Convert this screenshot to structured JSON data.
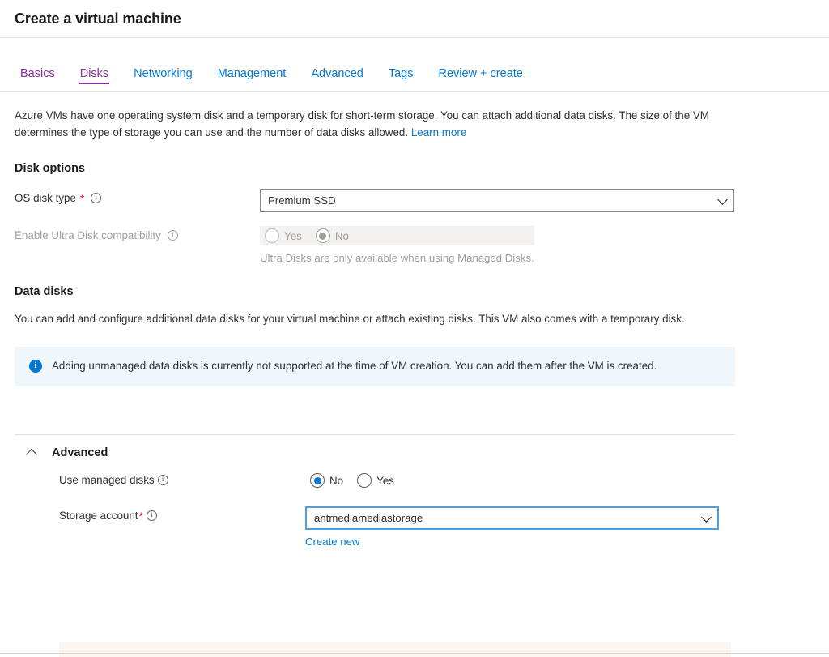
{
  "header": {
    "title": "Create a virtual machine"
  },
  "tabs": [
    {
      "label": "Basics",
      "state": "visited"
    },
    {
      "label": "Disks",
      "state": "active"
    },
    {
      "label": "Networking",
      "state": "default"
    },
    {
      "label": "Management",
      "state": "default"
    },
    {
      "label": "Advanced",
      "state": "default"
    },
    {
      "label": "Tags",
      "state": "default"
    },
    {
      "label": "Review + create",
      "state": "default"
    }
  ],
  "intro": {
    "text": "Azure VMs have one operating system disk and a temporary disk for short-term storage. You can attach additional data disks. The size of the VM determines the type of storage you can use and the number of data disks allowed.",
    "link_label": "Learn more"
  },
  "disk_options": {
    "heading": "Disk options",
    "os_disk_type": {
      "label": "OS disk type",
      "required_marker": "*",
      "value": "Premium SSD",
      "info_icon": "info-icon",
      "chevron_icon": "chevron-down-icon"
    },
    "ultra_disk": {
      "label": "Enable Ultra Disk compatibility",
      "info_icon": "info-icon",
      "options": [
        {
          "label": "Yes",
          "checked": false
        },
        {
          "label": "No",
          "checked": true
        }
      ],
      "hint": "Ultra Disks are only available when using Managed Disks.",
      "disabled": true
    }
  },
  "data_disks": {
    "heading": "Data disks",
    "description": "You can add and configure additional data disks for your virtual machine or attach existing disks. This VM also comes with a temporary disk.",
    "banner": {
      "icon": "info-circle-icon",
      "text": "Adding unmanaged data disks is currently not supported at the time of VM creation. You can add them after the VM is created.",
      "background_color": "#eff6fc",
      "icon_color": "#0078d4"
    }
  },
  "advanced": {
    "title": "Advanced",
    "collapse_icon": "chevron-up-icon",
    "expanded": true,
    "use_managed_disks": {
      "label": "Use managed disks",
      "info_icon": "info-icon",
      "options": [
        {
          "label": "No",
          "checked": true
        },
        {
          "label": "Yes",
          "checked": false
        }
      ]
    },
    "storage_account": {
      "label": "Storage account",
      "required_marker": "*",
      "info_icon": "info-icon",
      "value": "antmediamediastorage",
      "chevron_icon": "chevron-down-icon",
      "create_new_label": "Create new",
      "focused": true
    }
  },
  "colors": {
    "accent_blue": "#0078d4",
    "tab_visited_purple": "#8b2fa0",
    "required_red": "#e81123",
    "info_banner_bg": "#eff6fc",
    "warning_banner_bg": "#fdf6f0",
    "disabled_text": "#a19f9d"
  }
}
